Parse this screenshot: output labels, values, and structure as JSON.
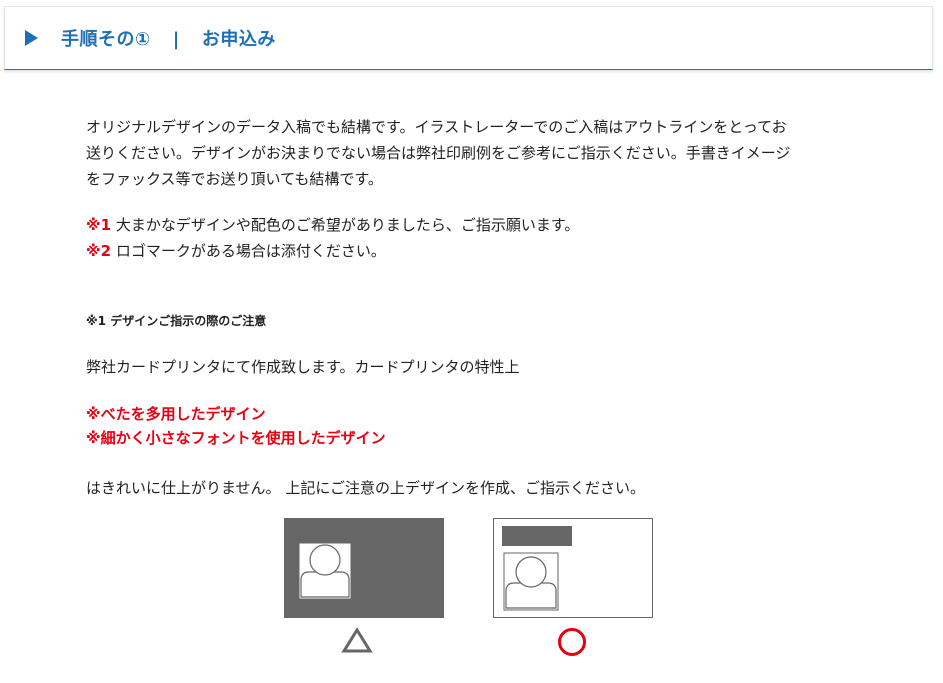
{
  "header": {
    "step": "手順その①",
    "separator": "|",
    "title": "お申込み"
  },
  "intro": {
    "line1": "オリジナルデザインのデータ入稿でも結構です。イラストレーターでのご入稿はアウトラインをとってお",
    "line2": "送りください。デザインがお決まりでない場合は弊社印刷例をご参考にご指示ください。手書きイメージ",
    "line3": "をファックス等でお送り頂いても結構です。"
  },
  "notes": [
    {
      "mark": "※1",
      "text": "大まかなデザインや配色のご希望がありましたら、ご指示願います。"
    },
    {
      "mark": "※2",
      "text": "ロゴマークがある場合は添付ください。"
    }
  ],
  "caution": {
    "heading": "※1 デザインご指示の際のご注意",
    "lead": "弊社カードプリンタにて作成致します。カードプリンタの特性上",
    "warning1": "※べたを多用したデザイン",
    "warning2": "※細かく小さなフォントを使用したデザイン",
    "tail": "はきれいに仕上がりません。 上記にご注意の上デザインを作成、ご指示ください。"
  },
  "examples": {
    "bad_symbol": "triangle",
    "good_symbol": "circle"
  },
  "colors": {
    "brand_blue": "#1f6fb5",
    "warning_red": "#e60012",
    "card_dark": "#666666"
  }
}
